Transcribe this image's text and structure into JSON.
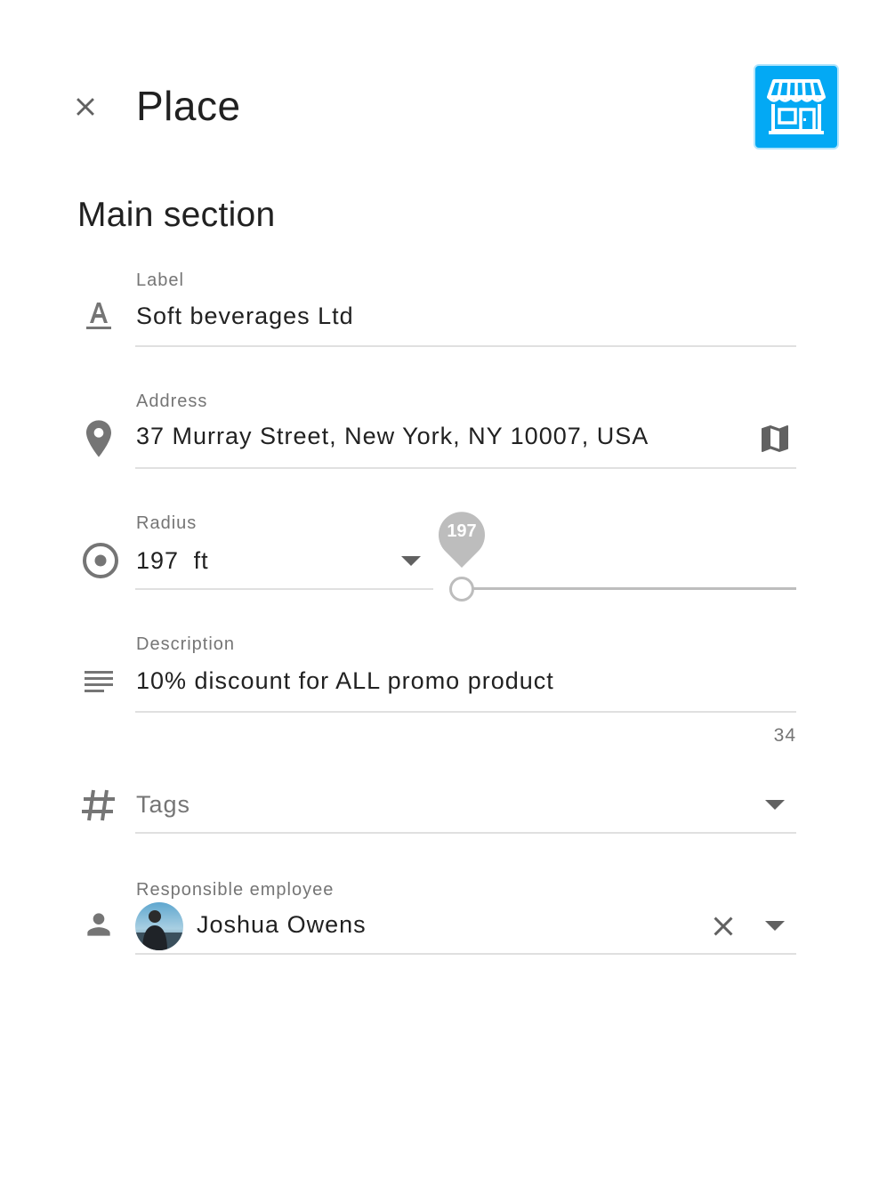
{
  "header": {
    "title": "Place",
    "close_icon": "close-icon",
    "place_type_icon": "storefront-icon",
    "accent_color": "#03a9f4"
  },
  "main_section": {
    "title": "Main section",
    "label_field": {
      "label": "Label",
      "value": "Soft beverages Ltd",
      "icon": "text-format-icon"
    },
    "address_field": {
      "label": "Address",
      "value": "37 Murray Street, New York, NY 10007, USA",
      "icon": "location-pin-icon",
      "action_icon": "map-icon"
    },
    "radius_field": {
      "label": "Radius",
      "value": "197",
      "unit": "ft",
      "icon": "radio-target-icon",
      "slider_value": "197",
      "slider_fraction": 0
    },
    "description_field": {
      "label": "Description",
      "value": "10% discount for ALL promo product",
      "counter": "34",
      "icon": "notes-icon"
    },
    "tags_field": {
      "placeholder": "Tags",
      "icon": "hashtag-icon"
    },
    "employee_field": {
      "label": "Responsible employee",
      "value": "Joshua Owens",
      "icon": "person-icon"
    }
  }
}
